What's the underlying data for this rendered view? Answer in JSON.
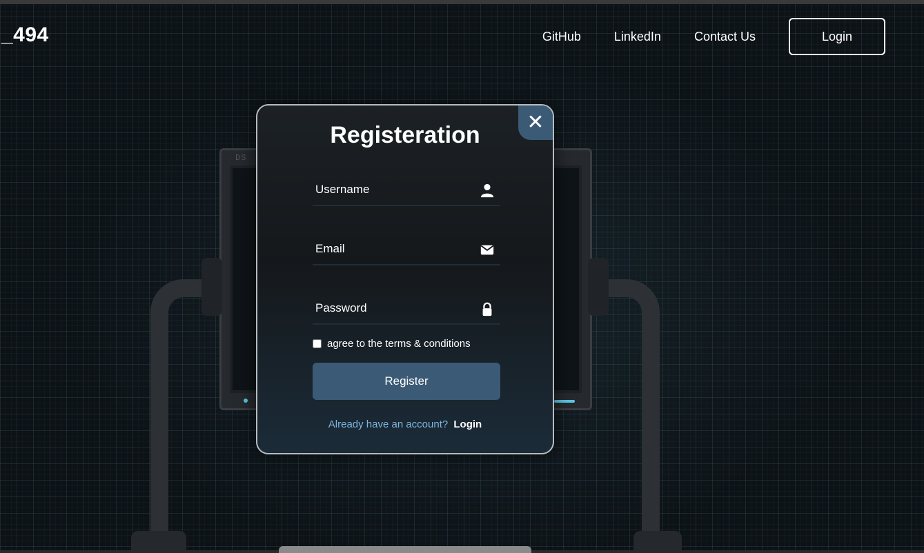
{
  "brand": {
    "logo_text": "_494"
  },
  "nav": {
    "links": [
      {
        "label": "GitHub"
      },
      {
        "label": "LinkedIn"
      },
      {
        "label": "Contact Us"
      }
    ],
    "login_label": "Login"
  },
  "background": {
    "monitor_brand": "DS"
  },
  "modal": {
    "close_symbol": "✕",
    "title": "Registeration",
    "fields": {
      "username": {
        "placeholder": "Username",
        "icon": "user-icon"
      },
      "email": {
        "placeholder": "Email",
        "icon": "envelope-icon"
      },
      "password": {
        "placeholder": "Password",
        "icon": "lock-icon"
      }
    },
    "terms_label": "agree to the terms & conditions",
    "register_label": "Register",
    "switch_text": "Already have an account?",
    "switch_link": "Login"
  },
  "colors": {
    "accent": "#3b5a75",
    "link_text": "#7eb6e0",
    "modal_border": "#b8bcc0"
  }
}
